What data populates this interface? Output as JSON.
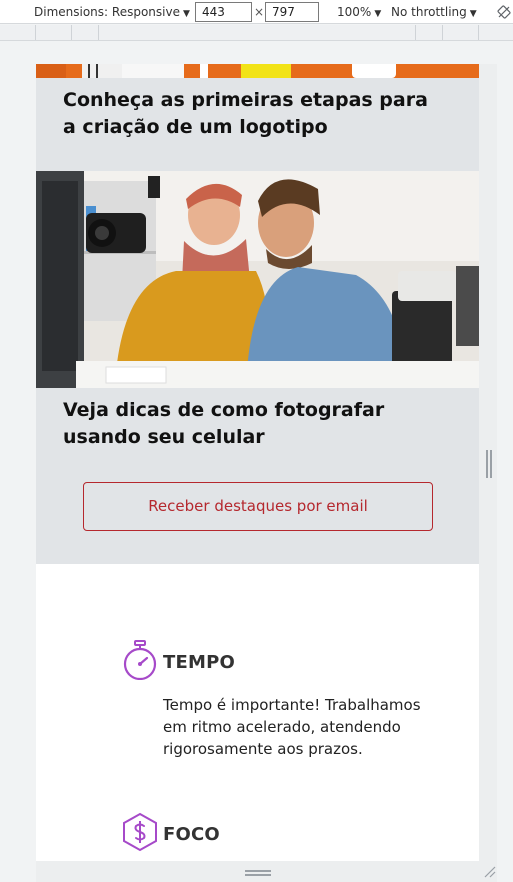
{
  "devtools": {
    "dimensions_label": "Dimensions: Responsive",
    "width_value": "443",
    "times": "×",
    "height_value": "797",
    "zoom": "100%",
    "throttling": "No throttling",
    "caret": "▼",
    "rotate_icon": "rotate-icon"
  },
  "page": {
    "cards": [
      {
        "title": "Conheça as primeiras etapas para a criação de um logotipo"
      },
      {
        "title": "Veja dicas de como fotografar usando seu celular",
        "image": "photographers-photo"
      }
    ],
    "cta_label": "Receber destaques por email",
    "features": [
      {
        "icon": "stopwatch-icon",
        "title": "TEMPO",
        "text": "Tempo é importante! Trabalhamos em ritmo acelerado, atendendo rigorosamente aos prazos."
      },
      {
        "icon": "dollar-hexagon-icon",
        "title": "FOCO"
      }
    ]
  },
  "colors": {
    "accent_red": "#b5282e",
    "icon_purple": "#a64ac9",
    "section_grey": "#e1e4e7"
  }
}
